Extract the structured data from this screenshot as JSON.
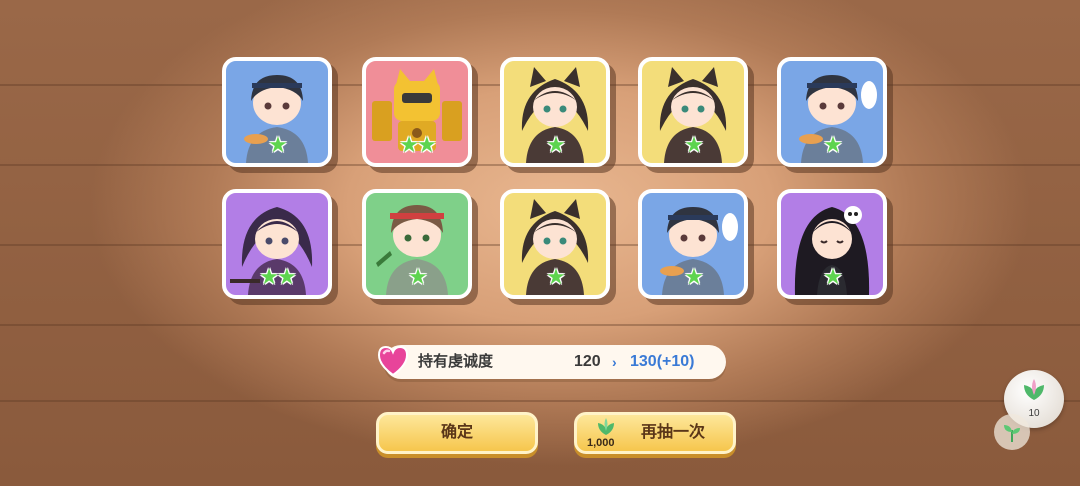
{
  "cards": [
    {
      "name": "card-1",
      "bg": "blue",
      "character": "headband-girl-with-bowl",
      "stars": "★"
    },
    {
      "name": "card-2",
      "bg": "pink",
      "character": "yellow-robot-cat",
      "stars": "★★"
    },
    {
      "name": "card-3",
      "bg": "yellow",
      "character": "wolf-ear-girl",
      "stars": "★"
    },
    {
      "name": "card-4",
      "bg": "yellow",
      "character": "wolf-ear-girl",
      "stars": "★"
    },
    {
      "name": "card-5",
      "bg": "blue",
      "character": "headband-girl-with-bowl",
      "stars": "★"
    },
    {
      "name": "card-6",
      "bg": "purple",
      "character": "purple-hair-girl",
      "stars": "★★"
    },
    {
      "name": "card-7",
      "bg": "green",
      "character": "red-headband-girl",
      "stars": "★"
    },
    {
      "name": "card-8",
      "bg": "yellow",
      "character": "wolf-ear-girl",
      "stars": "★"
    },
    {
      "name": "card-9",
      "bg": "blue",
      "character": "headband-girl-with-bowl",
      "stars": "★"
    },
    {
      "name": "card-10",
      "bg": "purple",
      "character": "long-hair-girl-skull-clip",
      "stars": "★"
    }
  ],
  "loyalty": {
    "label": "持有虔诚度",
    "current": "120",
    "arrow": "›",
    "next": "130(+10)",
    "icon": "heart-gem-icon"
  },
  "buttons": {
    "confirm": "确定",
    "redraw": "再抽一次",
    "redraw_cost": "1,000",
    "cost_icon": "leaf-currency-icon"
  },
  "side_widget": {
    "resource_count": "10",
    "resource_icon": "leaf-currency-icon",
    "sprout_icon": "sprout-icon"
  },
  "colors": {
    "blue": "#7aa6e6",
    "pink": "#f08e98",
    "yellow": "#f3dd7a",
    "purple": "#b27ee6",
    "green": "#7fd089",
    "star": "#5ed44f",
    "button": "#f6c64d",
    "loyalty_next": "#3a7ad6"
  }
}
